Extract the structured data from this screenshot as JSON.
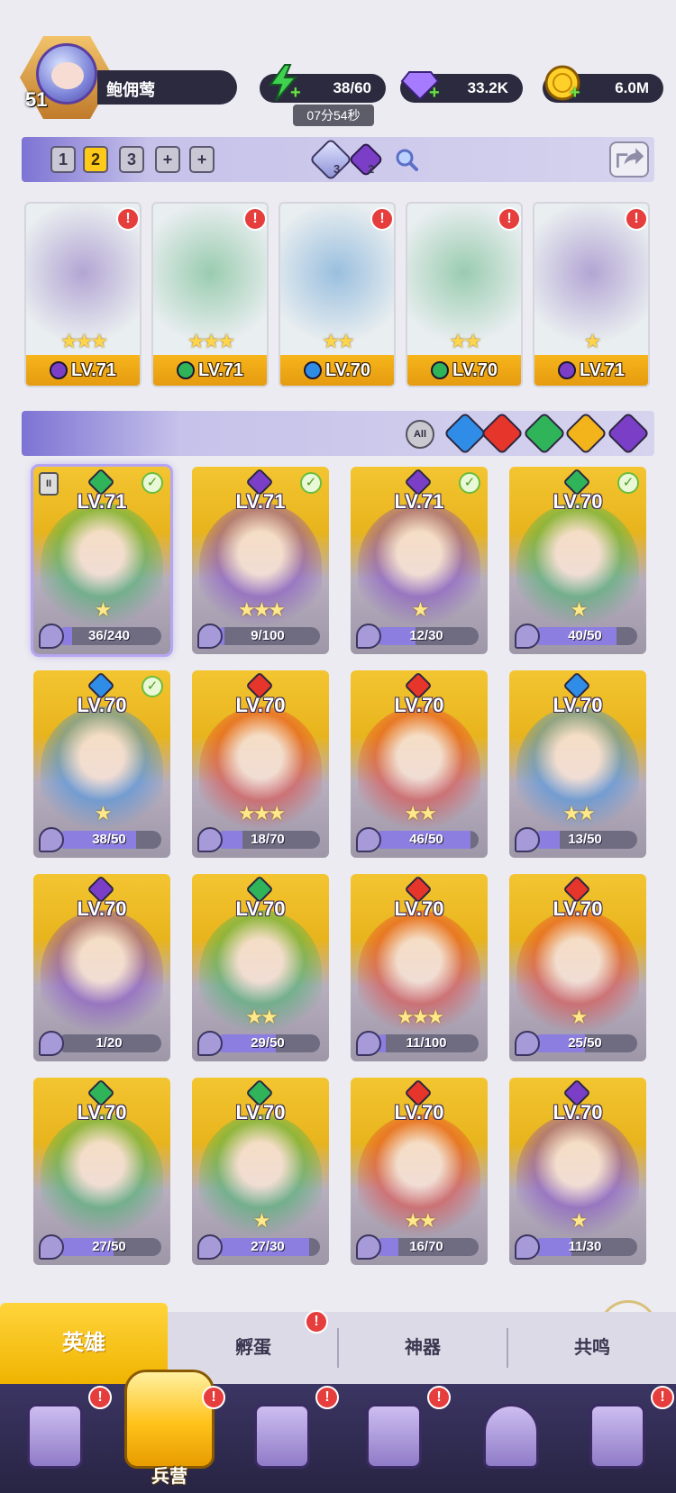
{
  "player": {
    "level": "51",
    "name": "鲍佣莺"
  },
  "resources": {
    "energy": "38/60",
    "energy_timer": "07分54秒",
    "gems": "33.2K",
    "gold": "6.0M"
  },
  "formation": {
    "tabs": [
      "1",
      "2",
      "3",
      "+",
      "+"
    ],
    "active_tab": "2",
    "item_a_count": "3",
    "item_b_count": "2"
  },
  "team": [
    {
      "level": "LV.71",
      "element": "dark",
      "stars": "★★★",
      "alert": "!"
    },
    {
      "level": "LV.71",
      "element": "nature",
      "stars": "★★★",
      "alert": "!"
    },
    {
      "level": "LV.70",
      "element": "water",
      "stars": "★★",
      "alert": "!"
    },
    {
      "level": "LV.70",
      "element": "nature",
      "stars": "★★",
      "alert": "!"
    },
    {
      "level": "LV.71",
      "element": "dark",
      "stars": "★",
      "alert": "!"
    }
  ],
  "filters": {
    "all_label": "All",
    "elements": [
      "water",
      "fire",
      "nature",
      "light",
      "dark"
    ]
  },
  "colors": {
    "water": "#2f8de8",
    "fire": "#e6352a",
    "nature": "#2fb45a",
    "light": "#f2b41a",
    "dark": "#7b3fc7"
  },
  "heroes": [
    {
      "level": "LV.71",
      "element": "nature",
      "progress": "36/240",
      "fraction": 0.15,
      "check": true,
      "selected": true,
      "stars": "★"
    },
    {
      "level": "LV.71",
      "element": "dark",
      "progress": "9/100",
      "fraction": 0.09,
      "check": true,
      "stars": "★★★"
    },
    {
      "level": "LV.71",
      "element": "dark",
      "progress": "12/30",
      "fraction": 0.4,
      "check": true,
      "stars": "★"
    },
    {
      "level": "LV.70",
      "element": "nature",
      "progress": "40/50",
      "fraction": 0.8,
      "check": true,
      "stars": "★"
    },
    {
      "level": "LV.70",
      "element": "water",
      "progress": "38/50",
      "fraction": 0.76,
      "check": true,
      "stars": "★"
    },
    {
      "level": "LV.70",
      "element": "fire",
      "progress": "18/70",
      "fraction": 0.26,
      "stars": "★★★"
    },
    {
      "level": "LV.70",
      "element": "fire",
      "progress": "46/50",
      "fraction": 0.92,
      "stars": "★★"
    },
    {
      "level": "LV.70",
      "element": "water",
      "progress": "13/50",
      "fraction": 0.26,
      "stars": "★★"
    },
    {
      "level": "LV.70",
      "element": "dark",
      "progress": "1/20",
      "fraction": 0.05,
      "stars": ""
    },
    {
      "level": "LV.70",
      "element": "nature",
      "progress": "29/50",
      "fraction": 0.58,
      "stars": "★★"
    },
    {
      "level": "LV.70",
      "element": "fire",
      "progress": "11/100",
      "fraction": 0.11,
      "stars": "★★★"
    },
    {
      "level": "LV.70",
      "element": "fire",
      "progress": "25/50",
      "fraction": 0.5,
      "stars": "★"
    },
    {
      "level": "LV.70",
      "element": "nature",
      "progress": "27/50",
      "fraction": 0.54,
      "stars": ""
    },
    {
      "level": "LV.70",
      "element": "nature",
      "progress": "27/30",
      "fraction": 0.9,
      "stars": "★"
    },
    {
      "level": "LV.70",
      "element": "fire",
      "progress": "16/70",
      "fraction": 0.23,
      "stars": "★★"
    },
    {
      "level": "LV.70",
      "element": "dark",
      "progress": "11/30",
      "fraction": 0.37,
      "stars": "★"
    }
  ],
  "sub_tabs": [
    "英雄",
    "孵蛋",
    "神器",
    "共鸣"
  ],
  "nav": {
    "active_label": "兵营"
  }
}
